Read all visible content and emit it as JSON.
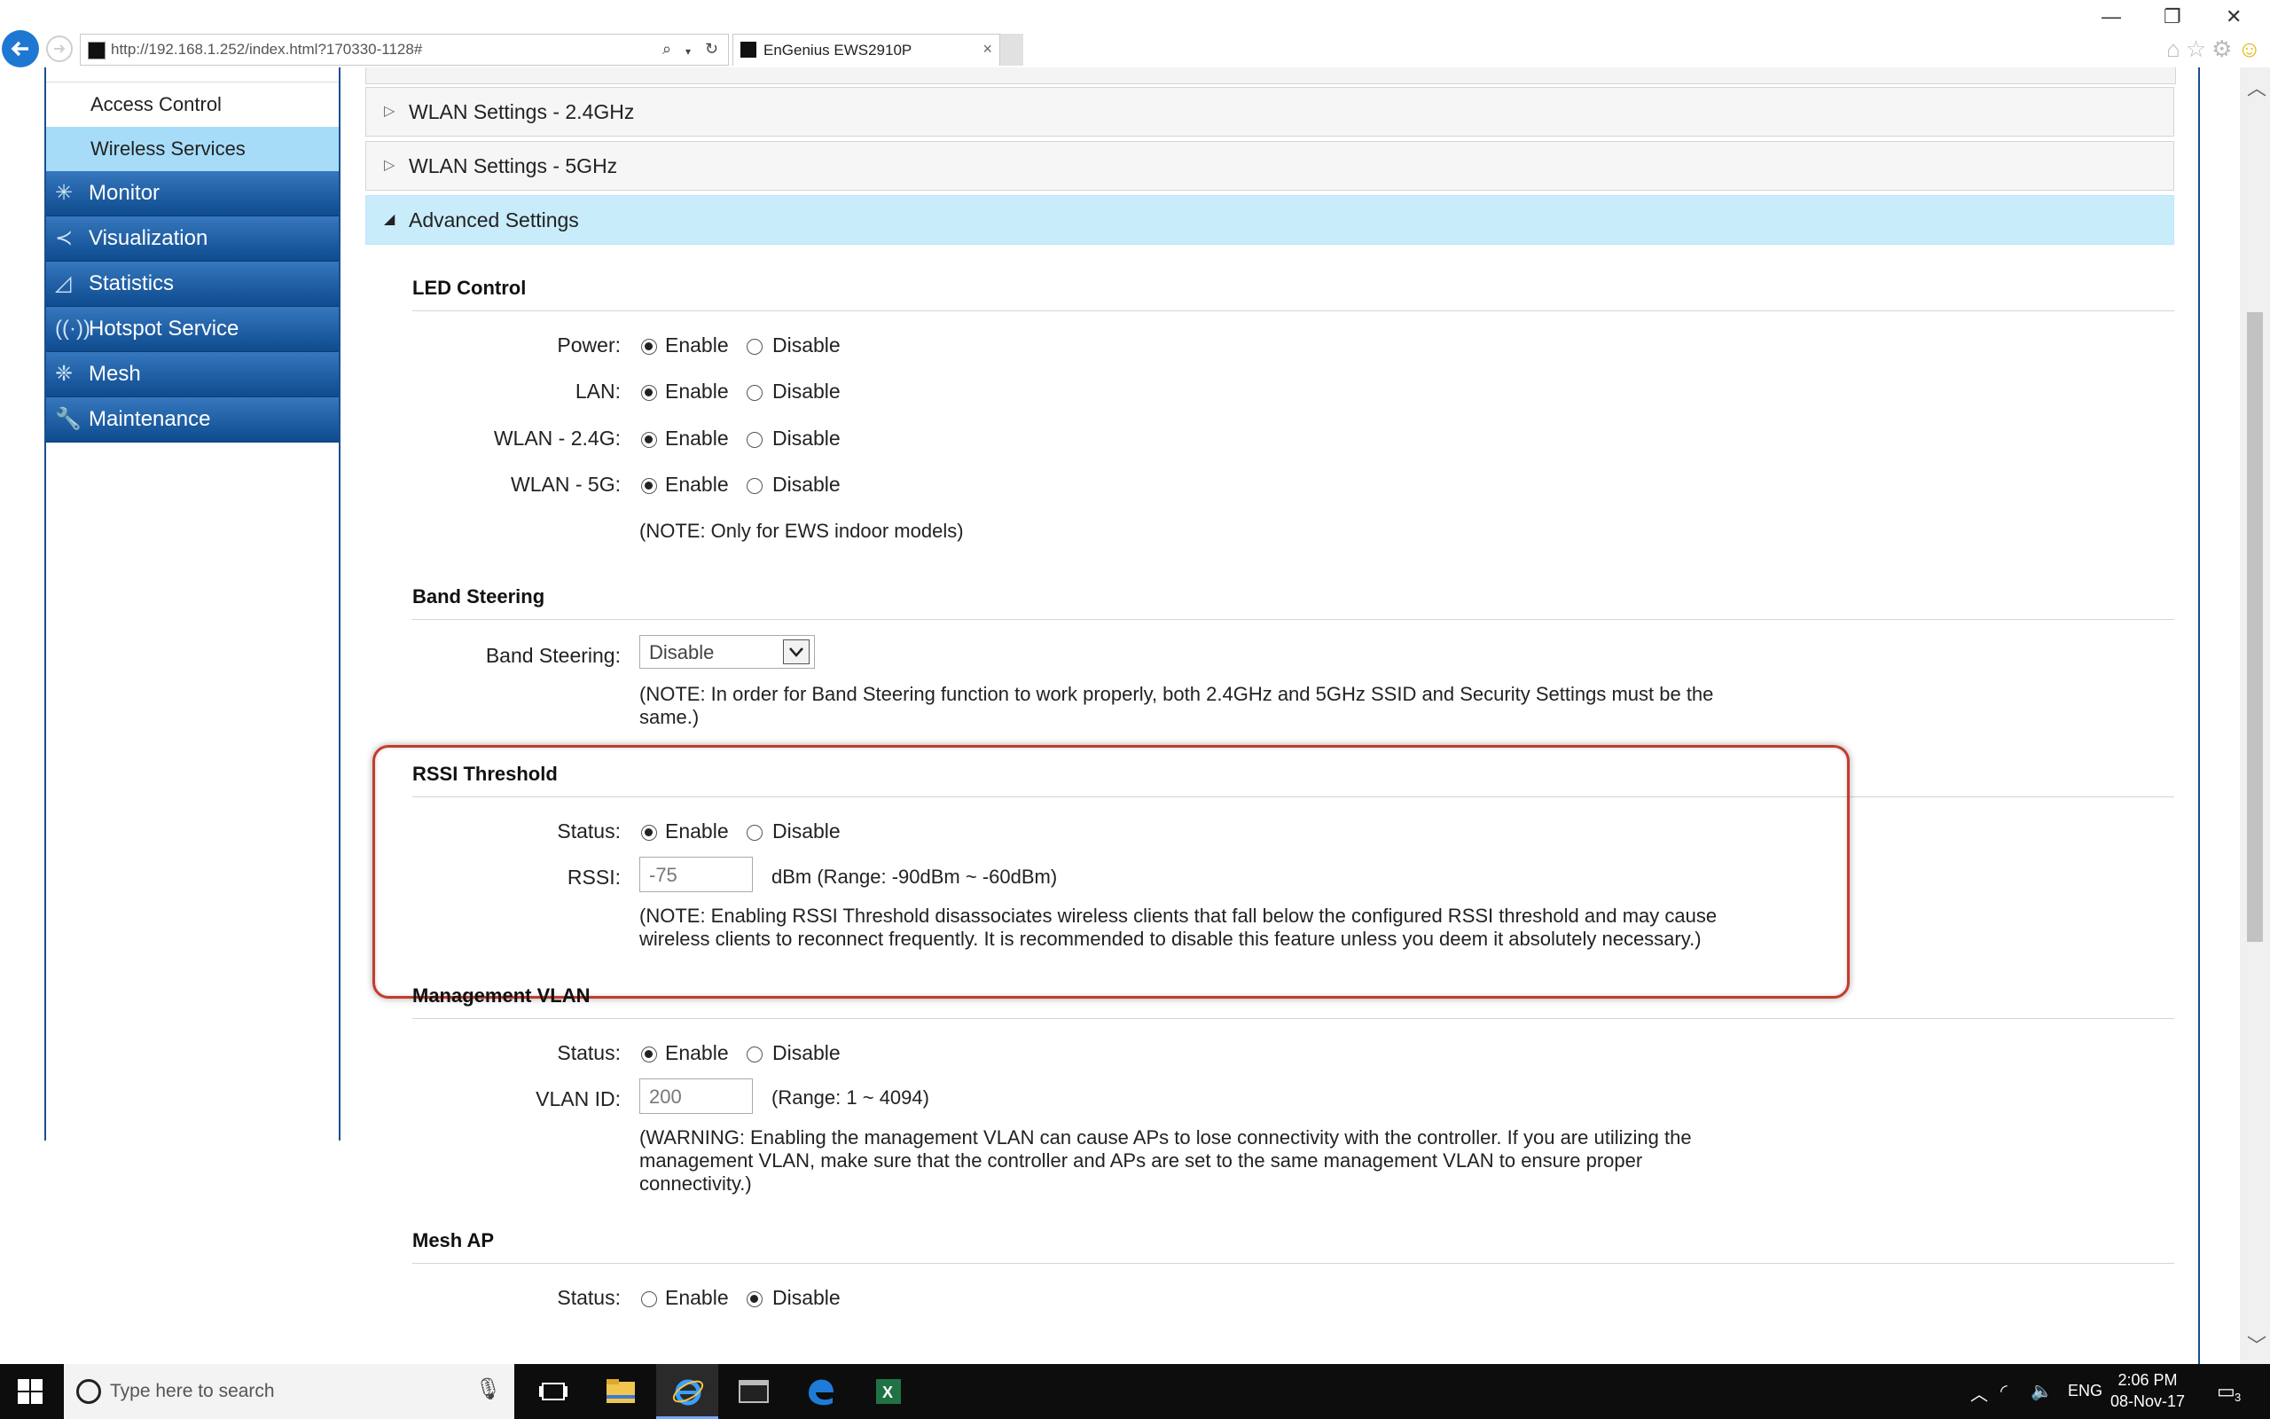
{
  "browser": {
    "url": "http://192.168.1.252/index.html?170330-1128#",
    "tab_title": "EnGenius EWS2910P",
    "tab_close": "×",
    "min": "—",
    "restore": "❐",
    "close": "✕"
  },
  "sidebar": {
    "sub_items": [
      {
        "label": "Access Control",
        "active": false
      },
      {
        "label": "Wireless Services",
        "active": true
      }
    ],
    "nav_items": [
      {
        "label": "Monitor",
        "icon": "monitor-icon"
      },
      {
        "label": "Visualization",
        "icon": "share-icon"
      },
      {
        "label": "Statistics",
        "icon": "chart-icon"
      },
      {
        "label": "Hotspot Service",
        "icon": "hotspot-icon"
      },
      {
        "label": "Mesh",
        "icon": "mesh-icon"
      },
      {
        "label": "Maintenance",
        "icon": "wrench-icon"
      }
    ]
  },
  "accordion": {
    "wlan24": "WLAN Settings - 2.4GHz",
    "wlan5": "WLAN Settings - 5GHz",
    "advanced": "Advanced Settings"
  },
  "led_control": {
    "title": "LED Control",
    "enable": "Enable",
    "disable": "Disable",
    "rows": [
      {
        "label": "Power:",
        "value": "Enable"
      },
      {
        "label": "LAN:",
        "value": "Enable"
      },
      {
        "label": "WLAN - 2.4G:",
        "value": "Enable"
      },
      {
        "label": "WLAN - 5G:",
        "value": "Enable"
      }
    ],
    "note": "(NOTE: Only for EWS indoor models)"
  },
  "band_steering": {
    "title": "Band Steering",
    "label": "Band Steering:",
    "value": "Disable",
    "note_line1": "(NOTE: In order for Band Steering function to work properly, both 2.4GHz and 5GHz SSID and Security Settings must be the",
    "note_line2": "same.)"
  },
  "rssi": {
    "title": "RSSI Threshold",
    "status_label": "Status:",
    "status_value": "Enable",
    "rssi_label": "RSSI:",
    "rssi_value": "-75",
    "range": "dBm (Range: -90dBm ~ -60dBm)",
    "note_line1": "(NOTE: Enabling RSSI Threshold disassociates wireless clients that fall below the configured RSSI threshold and may cause",
    "note_line2": "wireless clients to reconnect frequently. It is recommended to disable this feature unless you deem it absolutely necessary.)"
  },
  "mgmt_vlan": {
    "title": "Management VLAN",
    "status_label": "Status:",
    "status_value": "Enable",
    "vlan_label": "VLAN ID:",
    "vlan_value": "200",
    "range": "(Range: 1 ~ 4094)",
    "warn_line1": "(WARNING: Enabling the management VLAN can cause APs to lose connectivity with the controller. If you are utilizing the",
    "warn_line2": "management VLAN, make sure that the controller and APs are set to the same management VLAN to ensure proper",
    "warn_line3": "connectivity.)"
  },
  "mesh_ap": {
    "title": "Mesh AP",
    "status_label": "Status:",
    "status_value": "Disable"
  },
  "taskbar": {
    "search_placeholder": "Type here to search",
    "lang": "ENG",
    "time": "2:06 PM",
    "date": "08-Nov-17",
    "notifications": "3"
  },
  "colors": {
    "nav_blue": "#0e4b8f",
    "active_sub": "#a6dcf8",
    "highlight_red": "#c53b2b"
  }
}
